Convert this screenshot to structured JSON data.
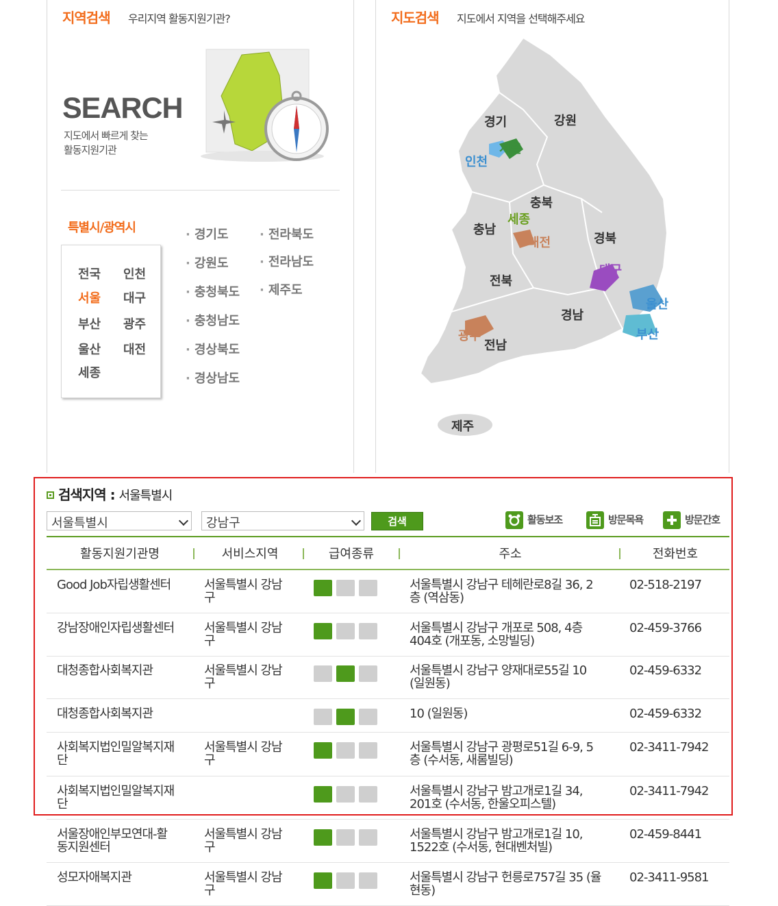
{
  "region_search": {
    "title": "지역검색",
    "subtitle": "우리지역 활동지원기관?",
    "big": "SEARCH",
    "desc_line1": "지도에서 빠르게 찾는",
    "desc_line2": "활동지원기관",
    "metro_title": "특별시/광역시",
    "metro": [
      "전국",
      "인천",
      "서울",
      "대구",
      "부산",
      "광주",
      "울산",
      "대전",
      "세종"
    ],
    "provinces_col1": [
      "경기도",
      "강원도",
      "충청북도",
      "충청남도",
      "경상북도",
      "경상남도"
    ],
    "provinces_col2": [
      "전라북도",
      "전라남도",
      "제주도"
    ]
  },
  "map_search": {
    "title": "지도검색",
    "subtitle": "지도에서 지역을 선택해주세요",
    "labels": {
      "gyeonggi": "경기",
      "gangwon": "강원",
      "seoul": "서울",
      "incheon": "인천",
      "chungbuk": "충북",
      "chungnam": "충남",
      "sejong": "세종",
      "daejeon": "대전",
      "gyeongbuk": "경북",
      "daegu": "대구",
      "jeonbuk": "전북",
      "ulsan": "울산",
      "gyeongnam": "경남",
      "busan": "부산",
      "gwangju": "광주",
      "jeonnam": "전남",
      "jeju": "제주"
    }
  },
  "results": {
    "label": "검색지역 :",
    "value": "서울특별시",
    "select_city": "서울특별시",
    "select_district": "강남구",
    "search_button": "검색",
    "legend": [
      "활동보조",
      "방문목욕",
      "방문간호"
    ],
    "headers": [
      "활동지원기관명",
      "서비스지역",
      "급여종류",
      "주소",
      "전화번호"
    ],
    "rows": [
      {
        "name_l1": "Good Job자립생활센터",
        "name_l2": "",
        "area_l1": "서울특별시 강남",
        "area_l2": "구",
        "addr_l1": "서울특별시 강남구 테헤란로8길 36, 2",
        "addr_l2": "층 (역삼동)",
        "phone": "02-518-2197",
        "icons": [
          1,
          0,
          0
        ]
      },
      {
        "name_l1": "강남장애인자립생활센터",
        "name_l2": "",
        "area_l1": "서울특별시 강남",
        "area_l2": "구",
        "addr_l1": "서울특별시 강남구 개포로 508, 4층",
        "addr_l2": "404호 (개포동, 소망빌딩)",
        "phone": "02-459-3766",
        "icons": [
          1,
          0,
          0
        ]
      },
      {
        "name_l1": "대청종합사회복지관",
        "name_l2": "",
        "area_l1": "서울특별시 강남",
        "area_l2": "구",
        "addr_l1": "서울특별시 강남구 양재대로55길 10",
        "addr_l2": "(일원동)",
        "phone": "02-459-6332",
        "icons": [
          0,
          1,
          0
        ]
      },
      {
        "name_l1": "대청종합사회복지관",
        "name_l2": "",
        "area_l1": "",
        "area_l2": "",
        "addr_l1": "10 (일원동)",
        "addr_l2": "",
        "phone": "02-459-6332",
        "icons": [
          0,
          1,
          0
        ]
      },
      {
        "name_l1": "사회복지법인밀알복지재",
        "name_l2": "단",
        "area_l1": "서울특별시 강남",
        "area_l2": "구",
        "addr_l1": "서울특별시 강남구 광평로51길 6-9, 5",
        "addr_l2": "층 (수서동, 새롬빌딩)",
        "phone": "02-3411-7942",
        "icons": [
          1,
          0,
          0
        ]
      },
      {
        "name_l1": "사회복지법인밀알복지재",
        "name_l2": "단",
        "area_l1": "",
        "area_l2": "",
        "addr_l1": "서울특별시 강남구 밤고개로1길 34,",
        "addr_l2": "201호 (수서동, 한울오피스텔)",
        "phone": "02-3411-7942",
        "icons": [
          1,
          0,
          0
        ]
      },
      {
        "name_l1": "서울장애인부모연대-활",
        "name_l2": "동지원센터",
        "area_l1": "서울특별시 강남",
        "area_l2": "구",
        "addr_l1": "서울특별시 강남구 밤고개로1길 10,",
        "addr_l2": "1522호 (수서동, 현대벤처빌)",
        "phone": "02-459-8441",
        "icons": [
          1,
          0,
          0
        ]
      },
      {
        "name_l1": "성모자애복지관",
        "name_l2": "",
        "area_l1": "서울특별시 강남",
        "area_l2": "구",
        "addr_l1": "서울특별시 강남구 헌릉로757길 35 (율",
        "addr_l2": "현동)",
        "phone": "02-3411-9581",
        "icons": [
          1,
          0,
          0
        ]
      }
    ]
  },
  "colors": {
    "accent": "#f26c1b",
    "green": "#5a9b1f",
    "red_box": "#e01c1c",
    "icon_on": "#4e9a1c",
    "icon_off": "#cfcfcf"
  }
}
